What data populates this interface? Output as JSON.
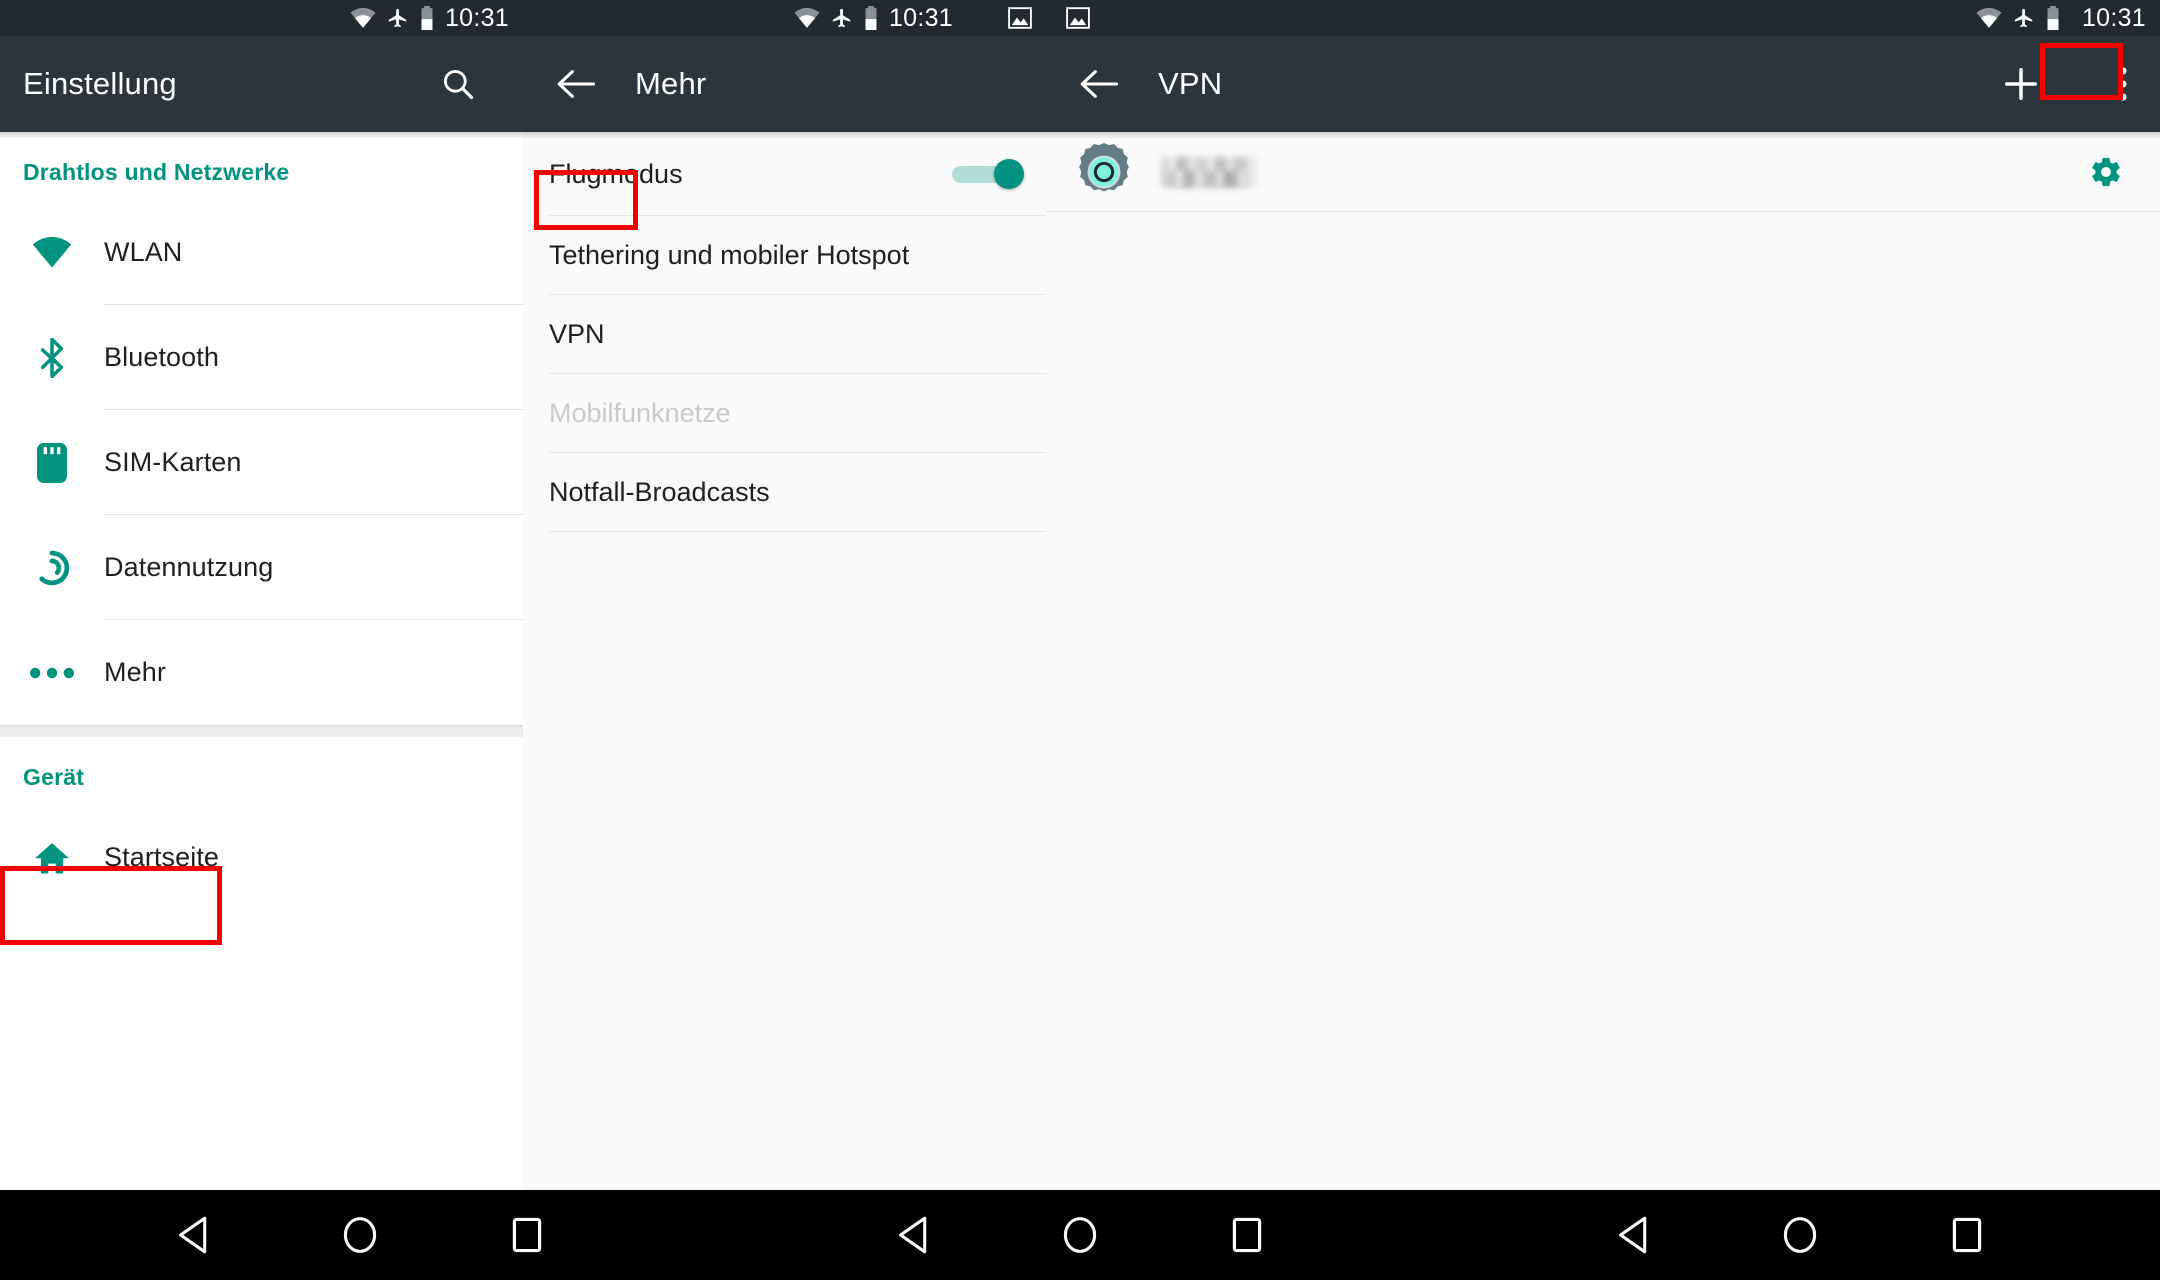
{
  "status_bar": {
    "time": "10:31",
    "icons": [
      "wifi-icon",
      "airplane-mode-icon",
      "battery-icon"
    ],
    "extra_icon": "screenshot-image-icon"
  },
  "colors": {
    "accent_teal": "#00937f",
    "appbar": "#2b353b",
    "statusbar": "#232a2e",
    "highlight_red": "#f50000",
    "navbar": "#000000"
  },
  "left_panel": {
    "appbar": {
      "title": "Einstellung",
      "search_icon": "search-icon"
    },
    "sections": [
      {
        "header": "Drahtlos und Netzwerke",
        "items": [
          {
            "label": "WLAN",
            "icon": "wifi-icon"
          },
          {
            "label": "Bluetooth",
            "icon": "bluetooth-icon"
          },
          {
            "label": "SIM-Karten",
            "icon": "sim-card-icon"
          },
          {
            "label": "Datennutzung",
            "icon": "data-usage-icon"
          },
          {
            "label": "Mehr",
            "icon": "more-dots-icon",
            "highlighted": true
          }
        ]
      },
      {
        "header": "Gerät",
        "items": [
          {
            "label": "Startseite",
            "icon": "home-icon"
          }
        ]
      }
    ]
  },
  "middle_panel": {
    "appbar": {
      "title": "Mehr",
      "back_icon": "back-arrow-icon"
    },
    "items": [
      {
        "label": "Flugmodus",
        "type": "switch",
        "switch_on": true
      },
      {
        "label": "Tethering und mobiler Hotspot",
        "type": "plain"
      },
      {
        "label": "VPN",
        "type": "plain",
        "highlighted": true
      },
      {
        "label": "Mobilfunknetze",
        "type": "plain",
        "disabled": true
      },
      {
        "label": "Notfall-Broadcasts",
        "type": "plain"
      }
    ]
  },
  "right_panel": {
    "appbar": {
      "title": "VPN",
      "back_icon": "back-arrow-icon",
      "add_icon": "plus-icon",
      "add_highlighted": true,
      "overflow_icon": "overflow-menu-icon"
    },
    "entries": [
      {
        "app_icon": "vpn-app-gear-icon",
        "name": "",
        "name_redacted": true,
        "settings_icon": "gear-settings-icon"
      }
    ]
  },
  "nav_bar": {
    "buttons": [
      "back-triangle-icon",
      "home-circle-icon",
      "recents-square-icon"
    ],
    "repeat_count": 3
  }
}
